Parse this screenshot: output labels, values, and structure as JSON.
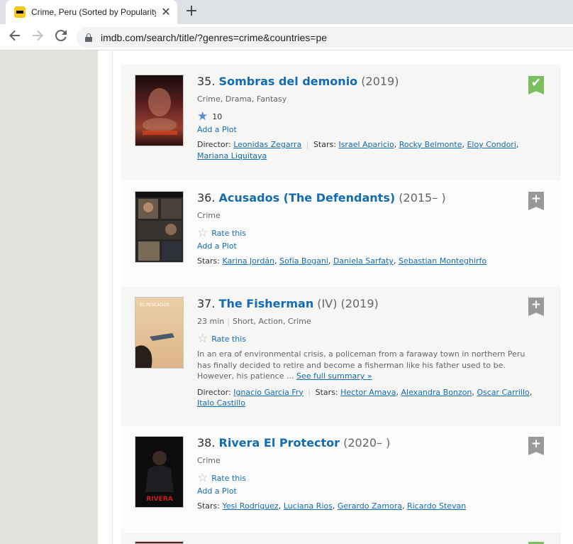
{
  "browser": {
    "tab_title": "Crime, Peru (Sorted by Popularity",
    "tab_close": "✕",
    "new_tab": "+",
    "url": "imdb.com/search/title/?genres=crime&countries=pe"
  },
  "results": [
    {
      "index": "35.",
      "title": "Sombras del demonio",
      "year": "(2019)",
      "genres": "Crime, Drama, Fantasy",
      "runtime": "",
      "rating": "10",
      "rated": true,
      "plot_link": "Add a Plot",
      "director_label": "Director:",
      "director": "Leonidas Zegarra",
      "stars_label": "Stars:",
      "stars": [
        "Israel Aparicio",
        "Rocky Belmonte",
        "Eloy Condori",
        "Mariana Liquitaya"
      ],
      "in_watchlist": true,
      "watchlist_glyph": "✔",
      "poster_colors": [
        "#3a1414",
        "#7a2a2a",
        "#c26a4a"
      ]
    },
    {
      "index": "36.",
      "title": "Acusados (The Defendants)",
      "year": "(2015– )",
      "genres": "Crime",
      "rate_label": "Rate this",
      "plot_link": "Add a Plot",
      "stars_label": "Stars:",
      "stars": [
        "Karina Jordán",
        "Sofía Bogani",
        "Daniela Sarfaty",
        "Sebastian Monteghirfo"
      ],
      "in_watchlist": false,
      "watchlist_glyph": "+",
      "poster_colors": [
        "#2a2824",
        "#5a4a3a",
        "#8c7a64"
      ]
    },
    {
      "index": "37.",
      "title": "The Fisherman",
      "extra": "(IV)",
      "year": "(2019)",
      "runtime": "23 min",
      "genres": "Short, Action, Crime",
      "rate_label": "Rate this",
      "plot": "In an era of environmental crisis, a policeman from a faraway town in northern Peru has finally decided to retire and become a fisherman like his father used to be. However, his patience ...",
      "see_full": "See full summary »",
      "director_label": "Director:",
      "director": "Ignacio Garcia Fry",
      "stars_label": "Stars:",
      "stars": [
        "Hector Amaya",
        "Alexandra Bonzon",
        "Oscar Carrillo",
        "Italo Castillo"
      ],
      "in_watchlist": false,
      "watchlist_glyph": "+",
      "poster_text": "EL PESCADOR",
      "poster_colors": [
        "#e8c9a0",
        "#d9b486",
        "#3a2a22"
      ]
    },
    {
      "index": "38.",
      "title": "Rivera El Protector",
      "year": "(2020– )",
      "genres": "Crime",
      "rate_label": "Rate this",
      "plot_link": "Add a Plot",
      "stars_label": "Stars:",
      "stars": [
        "Yesi Rodriguez",
        "Luciana Rios",
        "Gerardo Zamora",
        "Ricardo Stevan"
      ],
      "in_watchlist": false,
      "watchlist_glyph": "+",
      "poster_text": "RIVERA",
      "poster_colors": [
        "#0c0c0c",
        "#1e1e1e",
        "#b81c1c"
      ]
    }
  ]
}
